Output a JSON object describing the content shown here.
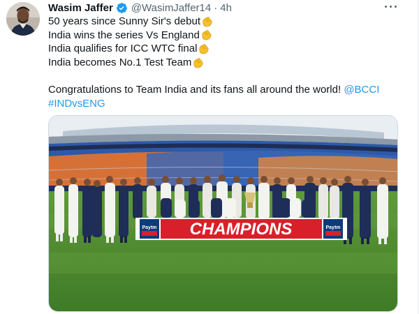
{
  "tweet": {
    "author": {
      "display_name": "Wasim Jaffer",
      "handle": "@WasimJaffer14",
      "verified": true,
      "avatar_icon": "profile-photo"
    },
    "separator": "·",
    "timestamp": "4h",
    "more_icon": "more-horizontal-icon",
    "lines": [
      {
        "text": "50 years since Sunny Sir's debut",
        "emoji": "clapping-hands"
      },
      {
        "text": "India wins the series Vs England",
        "emoji": "clapping-hands"
      },
      {
        "text": "India qualifies for ICC WTC final",
        "emoji": "clapping-hands"
      },
      {
        "text": "India becomes No.1 Test Team",
        "emoji": "clapping-hands"
      }
    ],
    "congrats_text": "Congratulations to Team India and its fans all around the world! ",
    "mention": "@BCCI",
    "hashtag": "#INDvsENG",
    "media": {
      "banner_text": "CHAMPIONS",
      "sponsor_logo": "Paytm TEST",
      "alt": "Indian cricket team posing with trophy in front of CHAMPIONS banner in stadium"
    }
  },
  "colors": {
    "link": "#1d9bf0",
    "secondary_text": "#536471",
    "verified": "#1d9bf0",
    "banner_red": "#d8202b",
    "grass": "#4e8a2f",
    "seat_orange": "#e8732a",
    "seat_blue": "#2d5aa8"
  }
}
